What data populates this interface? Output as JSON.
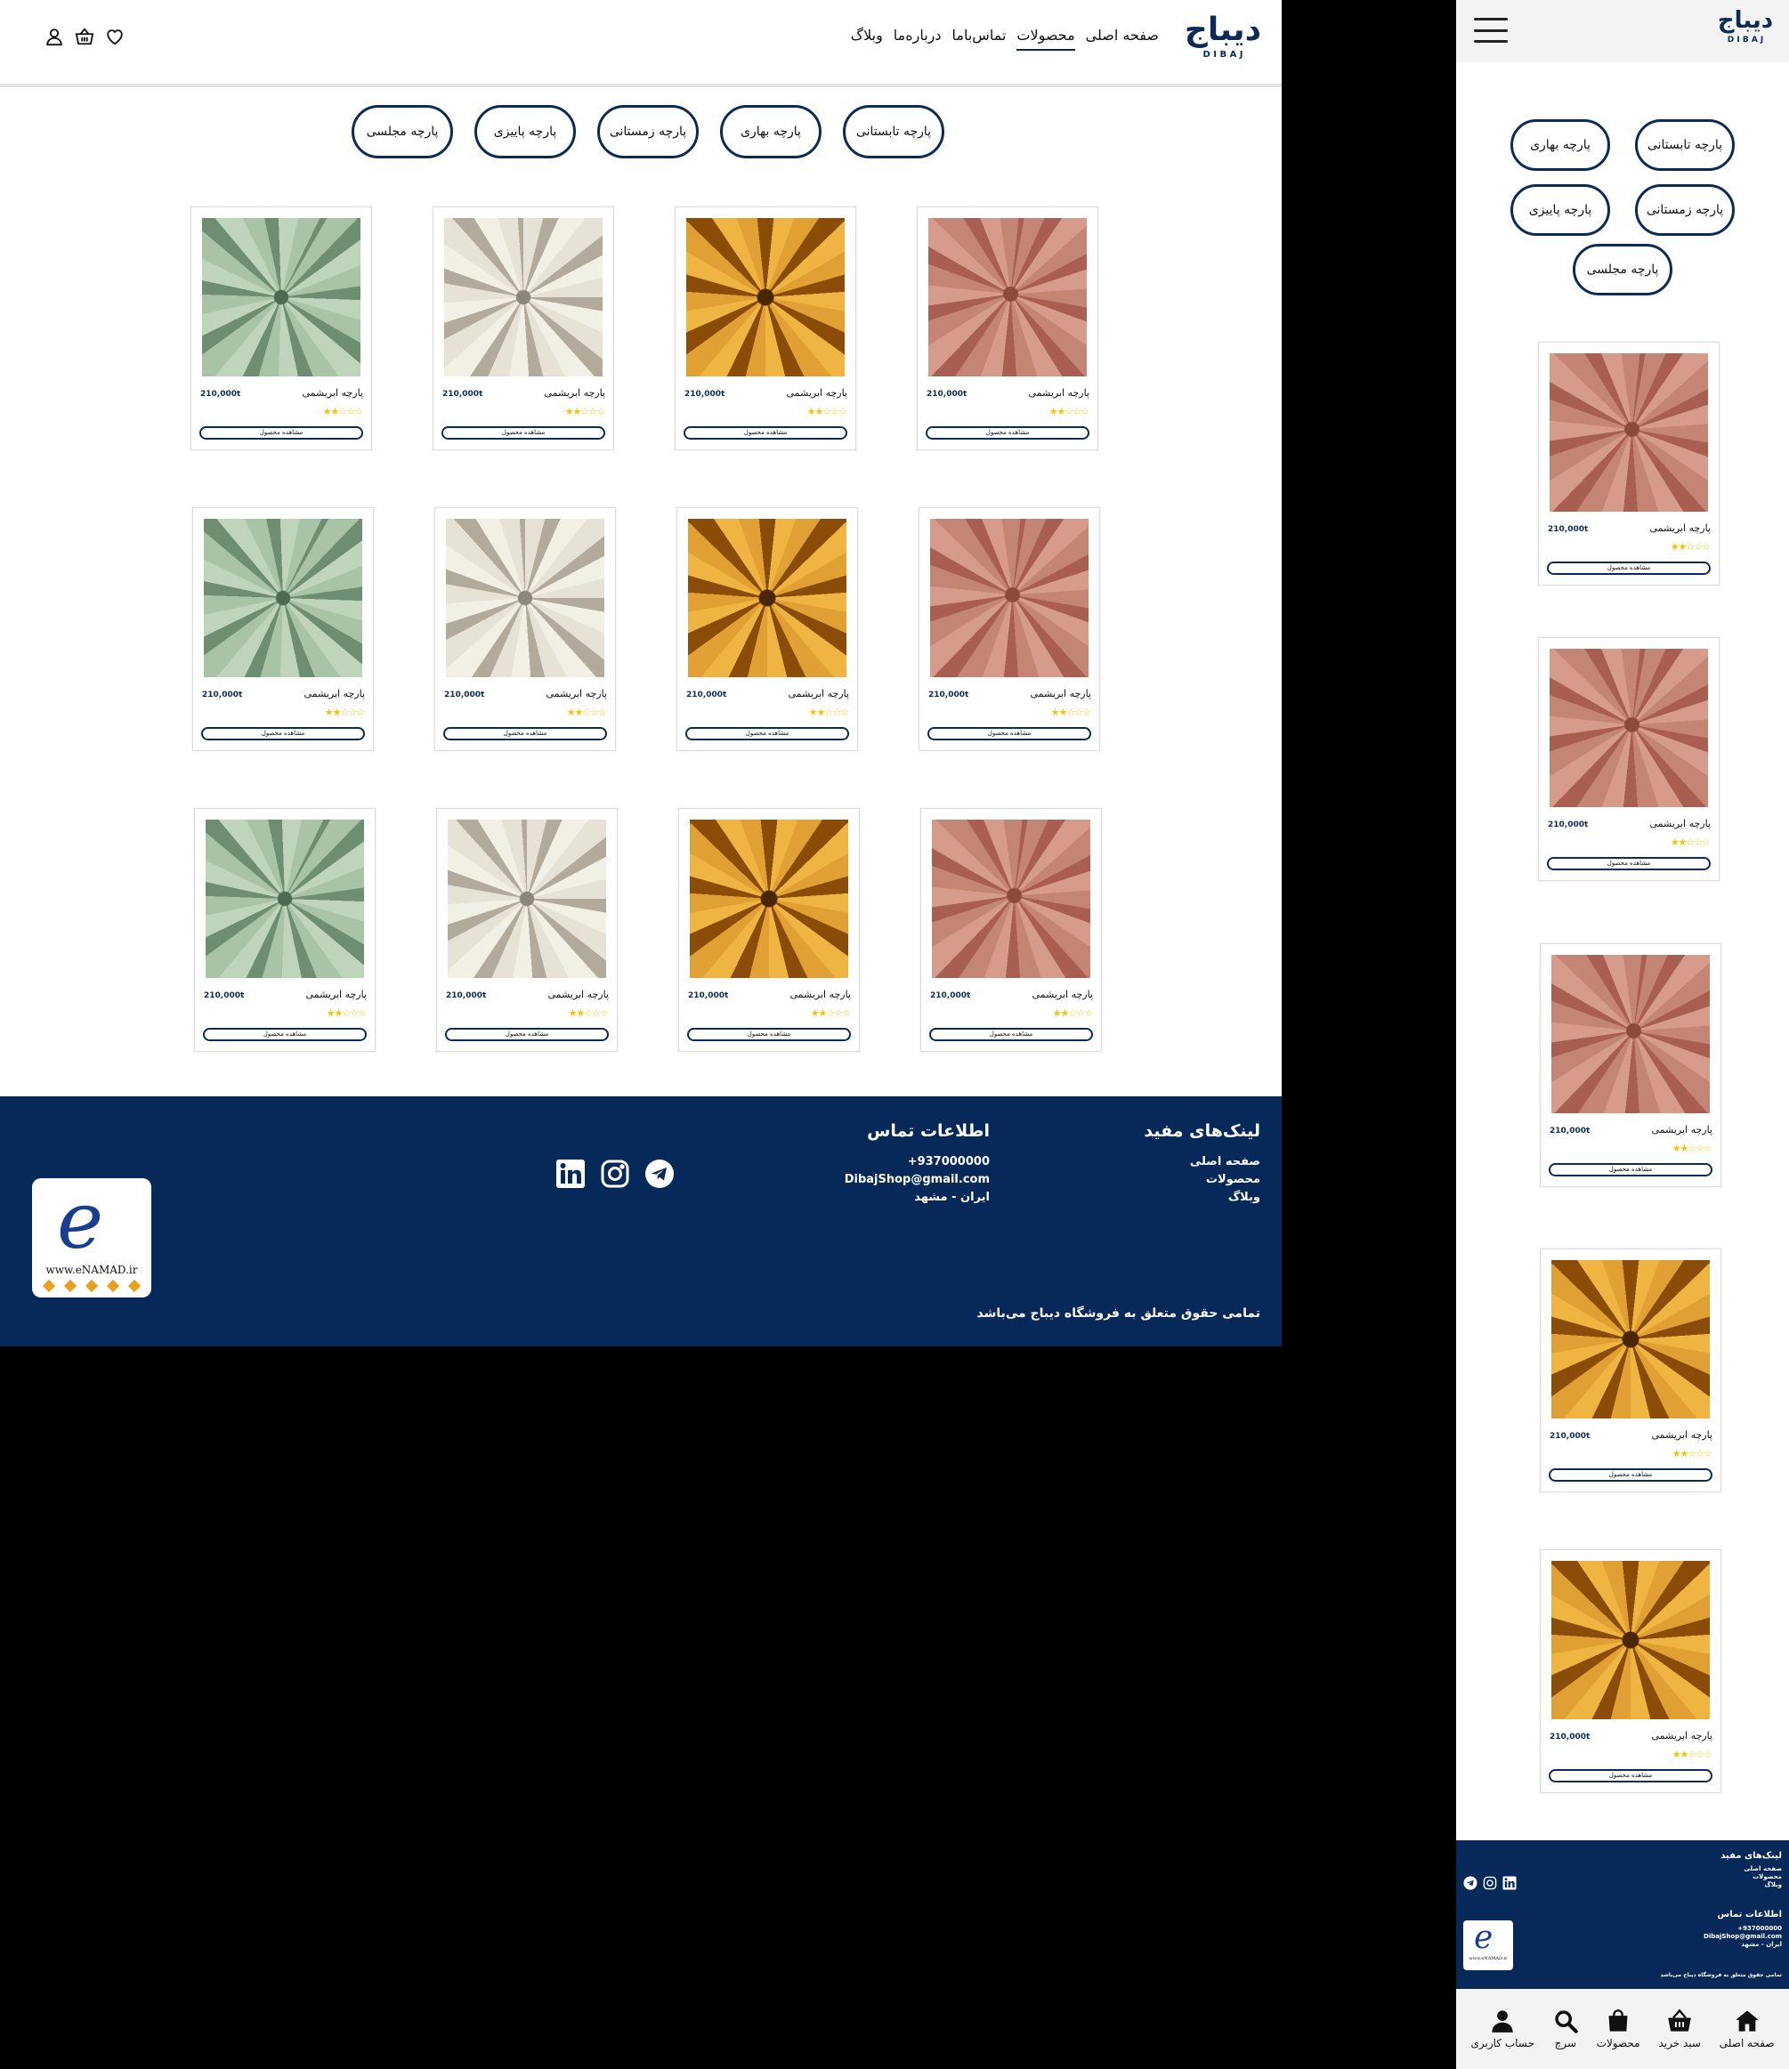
{
  "brand": {
    "name_fa": "دیباج",
    "name_en": "D I B A J"
  },
  "nav": [
    "صفحه اصلی",
    "محصولات",
    "تماس‌باما",
    "درباره‌ما",
    "وبلاگ"
  ],
  "filters": [
    "پارچه تابستانی",
    "پارچه بهاری",
    "پارچه زمستانی",
    "پارچه پاییزی",
    "پارچه مجلسی"
  ],
  "product": {
    "name": "پارچه ابریشمی",
    "price": "210,000t",
    "stars": "★★☆☆☆",
    "button": "مشاهده محصول"
  },
  "product_colors": [
    "pink",
    "orange",
    "cream",
    "green"
  ],
  "footer": {
    "links_title": "لینک‌های مفید",
    "links": [
      "صفحه اصلی",
      "محصولات",
      "وبلاگ"
    ],
    "contact_title": "اطلاعات تماس",
    "phone": "+937000000",
    "email": "DibajShop@gmail.com",
    "address": "ایران - مشهد",
    "copyright": "تمامی حقوق متعلق به فروشگاه دیباج می‌باشد",
    "enamad": "www.eNAMAD.ir"
  },
  "mobile_tabbar": [
    "صفحه اصلی",
    "سبد خرید",
    "محصولات",
    "سرچ",
    "حساب کاربری"
  ],
  "colors": {
    "navy": "#07295a",
    "accent": "#0d2a55",
    "star": "#f2c500"
  }
}
